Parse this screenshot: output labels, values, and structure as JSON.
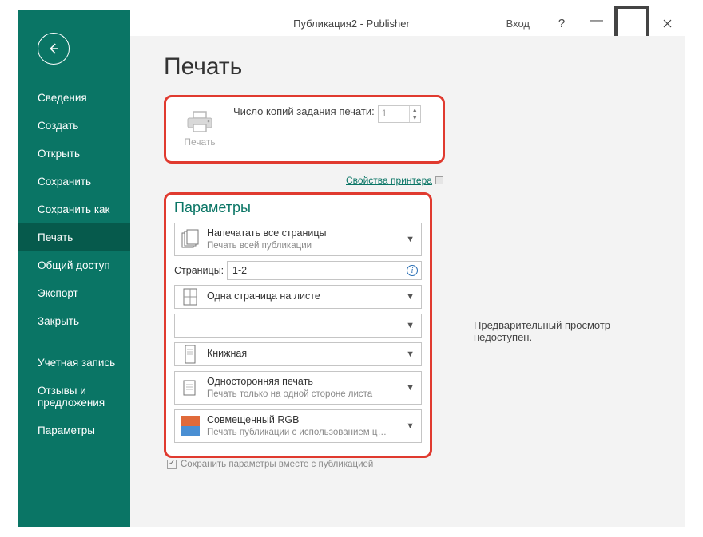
{
  "titlebar": {
    "title": "Публикация2  -  Publisher",
    "login": "Вход"
  },
  "sidebar": {
    "items": [
      {
        "label": "Сведения"
      },
      {
        "label": "Создать"
      },
      {
        "label": "Открыть"
      },
      {
        "label": "Сохранить"
      },
      {
        "label": "Сохранить как"
      },
      {
        "label": "Печать"
      },
      {
        "label": "Общий доступ"
      },
      {
        "label": "Экспорт"
      },
      {
        "label": "Закрыть"
      }
    ],
    "footer": [
      {
        "label": "Учетная запись"
      },
      {
        "label": "Отзывы и предложения"
      },
      {
        "label": "Параметры"
      }
    ]
  },
  "page": {
    "title": "Печать",
    "print_button": "Печать",
    "copies_label": "Число копий задания печати:",
    "copies_value": "1",
    "printer_props": "Свойства принтера",
    "params_title": "Параметры",
    "opt_all_pages": {
      "title": "Напечатать все страницы",
      "sub": "Печать всей публикации"
    },
    "pages_label": "Страницы:",
    "pages_value": "1-2",
    "opt_per_sheet": {
      "title": "Одна страница на листе"
    },
    "opt_orientation": {
      "title": "Книжная"
    },
    "opt_oneside": {
      "title": "Односторонняя печать",
      "sub": "Печать только на одной стороне листа"
    },
    "opt_rgb": {
      "title": "Совмещенный RGB",
      "sub": "Печать публикации с использованием ц…"
    },
    "save_params": "Сохранить параметры вместе с публикацией",
    "preview_unavailable": "Предварительный просмотр недоступен."
  },
  "colors": {
    "accent": "#0a7565",
    "highlight": "#e03a2f"
  }
}
